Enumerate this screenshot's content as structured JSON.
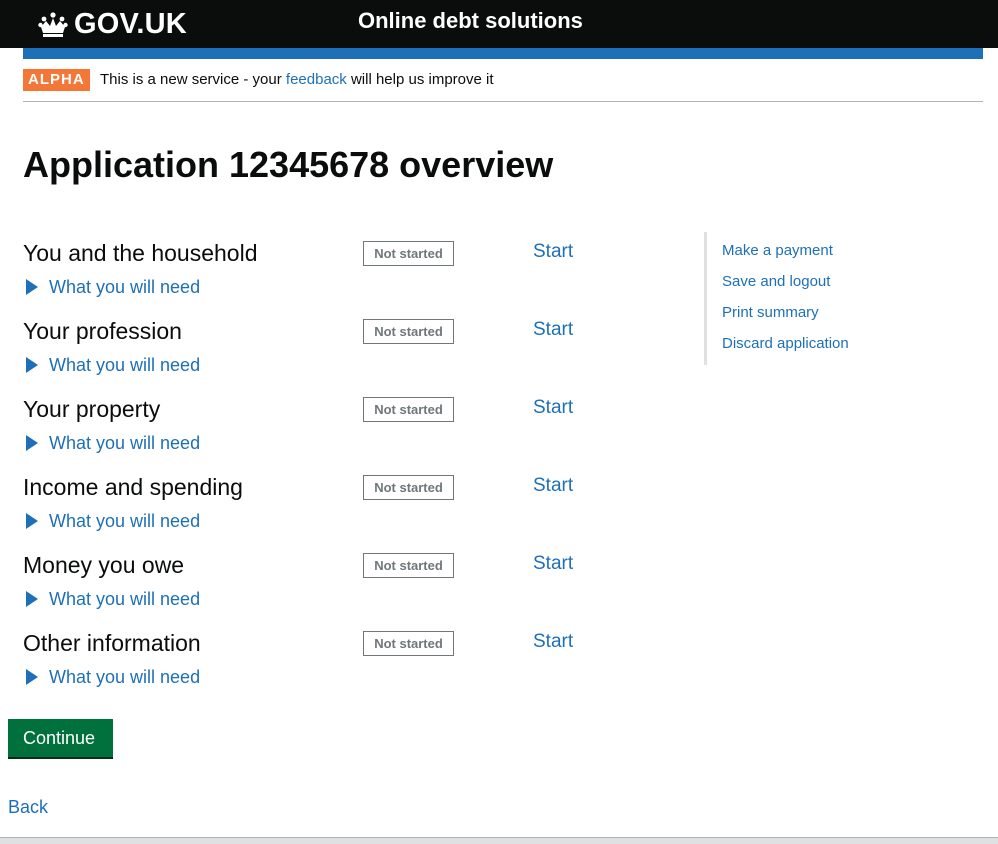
{
  "header": {
    "logo_text": "GOV.UK",
    "service_name": "Online debt solutions",
    "colors": {
      "header_bg": "#0b0c0c",
      "blue_bar": "#1d70b8"
    }
  },
  "phase_banner": {
    "tag": "ALPHA",
    "text_before": "This is a new service - your",
    "link": "feedback",
    "text_after": "will help us improve it",
    "tag_color": "#f47738"
  },
  "page_title": "Application 12345678 overview",
  "tasks": [
    {
      "title": "You and the household",
      "status": "Not started",
      "action": "Start",
      "details": "What you will need"
    },
    {
      "title": "Your profession",
      "status": "Not started",
      "action": "Start",
      "details": "What you will need"
    },
    {
      "title": "Your property",
      "status": "Not started",
      "action": "Start",
      "details": "What you will need"
    },
    {
      "title": "Income and spending",
      "status": "Not started",
      "action": "Start",
      "details": "What you will need"
    },
    {
      "title": "Money you owe",
      "status": "Not started",
      "action": "Start",
      "details": "What you will need"
    },
    {
      "title": "Other information",
      "status": "Not started",
      "action": "Start",
      "details": "What you will need"
    }
  ],
  "aside": {
    "links": [
      "Make a payment",
      "Save and logout",
      "Print summary",
      "Discard application"
    ]
  },
  "continue_label": "Continue",
  "back_label": "Back",
  "icons": {
    "logo": "crown-icon",
    "expand": "triangle-right-icon"
  },
  "colors": {
    "link": "#1d70b8",
    "button": "#00703c",
    "status": "#6f777b"
  }
}
